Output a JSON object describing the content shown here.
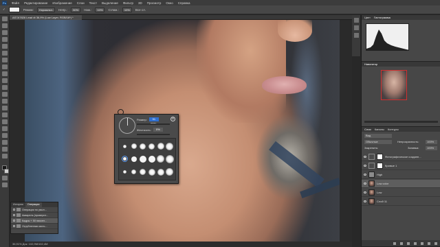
{
  "app": {
    "logo": "Ps",
    "menu": [
      "Файл",
      "Редактирование",
      "Изображение",
      "Слои",
      "Текст",
      "Выделение",
      "Фильтр",
      "3D",
      "Просмотр",
      "Окно",
      "Справка"
    ]
  },
  "options": {
    "mode_label": "Режим:",
    "mode_value": "Нормальн.",
    "opacity_label": "Непр.:",
    "opacity_value": "30%",
    "flow_label": "Наж.:",
    "flow_value": "10%",
    "smooth_label": "Сглаж.:",
    "smooth_value": "10%",
    "sample_label": "Все сл."
  },
  "document": {
    "tab_title": "AS7A7826 Lead dt 36,9% (Low Layer, RGB/16*) *",
    "status": "36,91%    Док: 102,9M/102,4M"
  },
  "brush_picker": {
    "size_label": "Размер:",
    "size_value": "91 пикс.",
    "hardness_label": "Жесткость:",
    "hardness_value": "0%"
  },
  "history": {
    "tabs": [
      "История",
      "Операции"
    ],
    "items": [
      {
        "label": "Операции по умол..."
      },
      {
        "label": "Акварель (проверит..."
      },
      {
        "label": "Кадры + 50 пиксел..."
      },
      {
        "label": "Огрубленная кисть..."
      }
    ]
  },
  "right_panels": {
    "histogram_tabs": [
      "Цвет",
      "Гистограмма"
    ],
    "navigator_title": "Навигатор",
    "layers_tabs": [
      "Слои",
      "Каналы",
      "Контуры"
    ],
    "layers_search": "Вид",
    "blend_mode": "Обычные",
    "opacity_label": "Непрозрачность:",
    "opacity_value": "100%",
    "lock_label": "Закрепить:",
    "fill_label": "Заливка:",
    "fill_value": "100%",
    "layers": [
      {
        "name": "Фотографическое созданн..."
      },
      {
        "name": "Кривые 1"
      },
      {
        "name": "High"
      },
      {
        "name": "Low color"
      },
      {
        "name": "Low"
      },
      {
        "name": "Слой 11"
      }
    ]
  },
  "colors": {
    "accent": "#2f6fd0",
    "panel": "#474747",
    "menubar": "#3c3c3c"
  }
}
